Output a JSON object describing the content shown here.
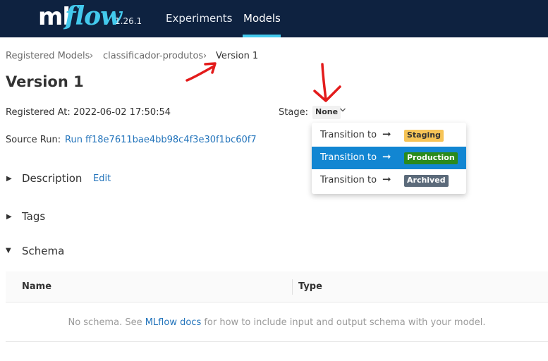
{
  "header": {
    "logo_ml": "ml",
    "logo_flow": "flow",
    "version": "1.26.1",
    "nav": [
      {
        "label": "Experiments"
      },
      {
        "label": "Models"
      }
    ],
    "colors": {
      "background": "#0e2240",
      "accent": "#43c9ed"
    }
  },
  "breadcrumb": {
    "items": [
      "Registered Models",
      "classificador-produtos",
      "Version 1"
    ],
    "separator": "›"
  },
  "page_title": "Version 1",
  "details": {
    "registered_at_label": "Registered At:",
    "registered_at_value": "2022-06-02 17:50:54",
    "stage_label": "Stage:",
    "stage_value": "None",
    "source_run_label": "Source Run:",
    "source_run_value": "Run ff18e7611bae4bb98c4f3e30f1bc60f7"
  },
  "stage_dropdown": {
    "items": [
      {
        "text": "Transition to",
        "target": "Staging",
        "active": false
      },
      {
        "text": "Transition to",
        "target": "Production",
        "active": true
      },
      {
        "text": "Transition to",
        "target": "Archived",
        "active": false
      }
    ],
    "arrow": "➞",
    "colors": {
      "active_row": "#1286d2",
      "staging": "#f6c457",
      "production": "#2a8a1c",
      "archived": "#5b6a7a"
    }
  },
  "sections": {
    "description": {
      "title": "Description",
      "edit_label": "Edit",
      "caret": "▶"
    },
    "tags": {
      "title": "Tags",
      "caret": "▶"
    },
    "schema": {
      "title": "Schema",
      "caret": "▼"
    }
  },
  "schema_table": {
    "columns": [
      "Name",
      "Type"
    ],
    "empty_prefix": "No schema. See ",
    "empty_link": "MLflow docs",
    "empty_suffix": " for how to include input and output schema with your model."
  },
  "annotations": {
    "color": "#e31b1b"
  }
}
